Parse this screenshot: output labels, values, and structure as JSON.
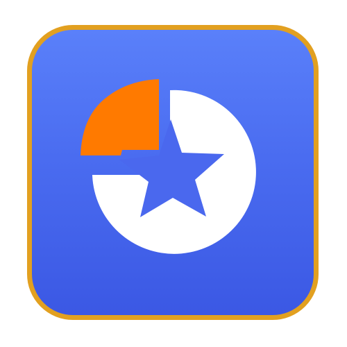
{
  "app_icon": {
    "name": "chart-star-app-icon",
    "icons": {
      "main": "pie-chart-star-icon",
      "accent": "orange-pie-slice-icon",
      "star": "star-icon"
    },
    "colors": {
      "border": "#E2A020",
      "background_top": "#5A80FA",
      "background_bottom": "#3B58E4",
      "pie": "#FFFFFF",
      "slice": "#FF7A00",
      "star": "#4A68EE"
    }
  }
}
